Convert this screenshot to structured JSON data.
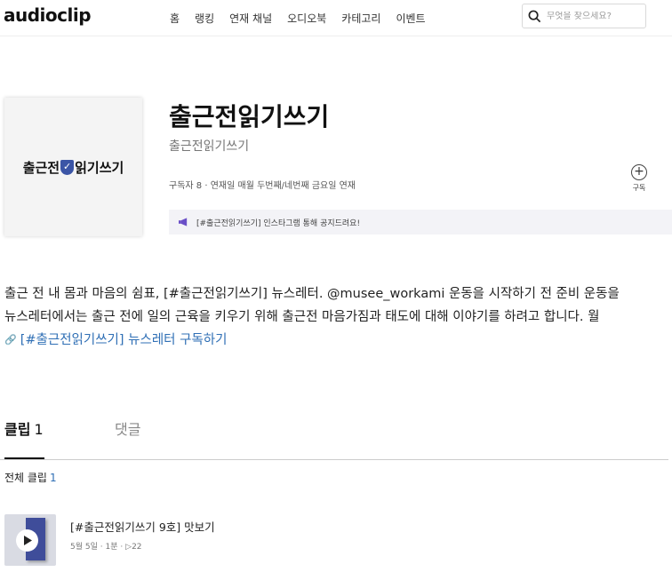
{
  "header": {
    "logo_part1": "audio",
    "logo_part2": "clip",
    "nav": [
      "홈",
      "랭킹",
      "연재 채널",
      "오디오북",
      "카테고리",
      "이벤트"
    ],
    "search_placeholder": "무엇을 찾으세요?"
  },
  "channel": {
    "cover_text_before": "출근전",
    "cover_badge": "✓",
    "cover_text_after": "읽기쓰기",
    "title": "출근전읽기쓰기",
    "subtitle": "출근전읽기쓰기",
    "subscribers_label": "구독자 8",
    "separator": "·",
    "schedule": "연재일 매월 두번째/네번째 금요일 연재",
    "subscribe_label": "구독",
    "notice": "[#출근전읽기쓰기] 인스타그램 통해 공지드려요!"
  },
  "description": {
    "line1": "출근 전 내 몸과 마음의 쉼표, [#출근전읽기쓰기] 뉴스레터. @musee_workami 운동을 시작하기 전 준비 운동을",
    "line2": "뉴스레터에서는 출근 전에 일의 근육을 키우기 위해 출근전 마음가짐과 태도에 대해 이야기를 하려고 합니다. 월",
    "link": "[#출근전읽기쓰기] 뉴스레터 구독하기"
  },
  "tabs": {
    "clips_label": "클립",
    "clips_count": "1",
    "comments_label": "댓글"
  },
  "all_clips": {
    "label": "전체 클립",
    "count": "1"
  },
  "episode": {
    "title": "[#출근전읽기쓰기 9호] 맛보기",
    "date": "5월 5일",
    "duration": "1분",
    "plays": "22"
  },
  "colors": {
    "accent_link": "#2f6fb5",
    "notice_icon": "#6a4fc7",
    "cover_badge": "#3b55a6"
  },
  "icons": [
    "search-icon",
    "plus-circle-icon",
    "megaphone-icon",
    "link-icon",
    "play-icon"
  ]
}
